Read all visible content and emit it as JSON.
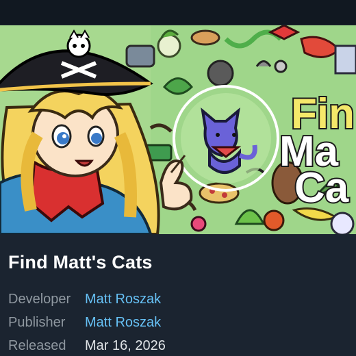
{
  "hero": {
    "art_title_line1": "Fin",
    "art_title_line2": "Ma",
    "art_title_line3": "Ca"
  },
  "game": {
    "title": "Find Matt's Cats",
    "developer_label": "Developer",
    "developer": "Matt Roszak",
    "publisher_label": "Publisher",
    "publisher": "Matt Roszak",
    "released_label": "Released",
    "release_date": "Mar 16, 2026"
  },
  "colors": {
    "background": "#1b2430",
    "link": "#66c0f4",
    "label": "#8f98a0"
  }
}
